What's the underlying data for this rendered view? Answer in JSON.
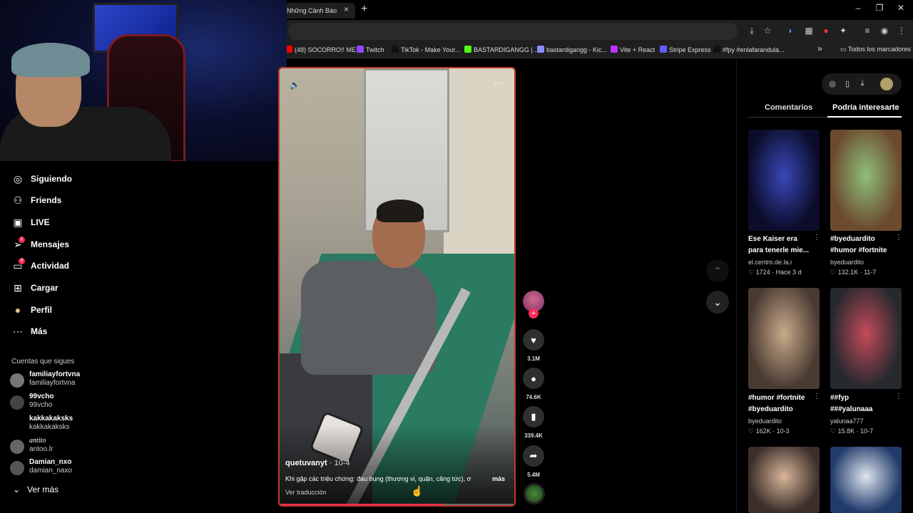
{
  "browser": {
    "tab_title": "Những Cảnh Báo",
    "tab_close": "×",
    "new_tab": "+",
    "win_minimize": "–",
    "win_restore": "❐",
    "win_close": "✕",
    "bookmarks": [
      {
        "label": "(48) SOCORRO!! ME...",
        "color": "#ff0000"
      },
      {
        "label": "Twitch",
        "color": "#9146ff"
      },
      {
        "label": "TikTok - Make Your...",
        "color": "#111111"
      },
      {
        "label": "BASTARDIGANGG |...",
        "color": "#53fc18"
      },
      {
        "label": "bastardigangg - Kic...",
        "color": "#8c8cff"
      },
      {
        "label": "Vite + React",
        "color": "#bd34fe"
      },
      {
        "label": "Stripe Express",
        "color": "#635bff"
      },
      {
        "label": "#fpy #enlafarandula...",
        "color": "#111111"
      }
    ],
    "bookmarks_overflow": "»",
    "all_bookmarks": "Todos los marcadores"
  },
  "sidebar": {
    "items": [
      {
        "label": "Siguiendo",
        "icon": "following-icon",
        "glyph": "◎"
      },
      {
        "label": "Friends",
        "icon": "friends-icon",
        "glyph": "⚇"
      },
      {
        "label": "LIVE",
        "icon": "live-icon",
        "glyph": "▣"
      },
      {
        "label": "Mensajes",
        "icon": "messages-icon",
        "glyph": "➢",
        "badge": "1"
      },
      {
        "label": "Actividad",
        "icon": "activity-icon",
        "glyph": "▭",
        "badge": "9"
      },
      {
        "label": "Cargar",
        "icon": "upload-icon",
        "glyph": "⊞"
      },
      {
        "label": "Perfil",
        "icon": "profile-icon",
        "glyph": "●"
      },
      {
        "label": "Más",
        "icon": "more-icon",
        "glyph": "⋯"
      }
    ],
    "following_title": "Cuentas que sigues",
    "accounts": [
      {
        "name": "familiayfortvna",
        "handle": "familiayfortvna",
        "color": "#777"
      },
      {
        "name": "99vcho",
        "handle": "99vcho",
        "color": "#444"
      },
      {
        "name": "kakkakaksks",
        "handle": "kakkakaksks",
        "color": "#000"
      },
      {
        "name": "antito",
        "handle": "antoo.lr",
        "color": "#666"
      },
      {
        "name": "Damian_nxo",
        "handle": "damian_naxo",
        "color": "#555"
      }
    ],
    "see_more": "Ver más"
  },
  "video": {
    "author": "quetuvanyt",
    "date": " · 10-4",
    "caption": "Khi gặp các triệu chứng: đau bụng (thượng vị, quặn, căng tức), ơ",
    "more": "más",
    "translate": "Ver traducción",
    "progress": 0.69,
    "mute_icon": "🔈",
    "more_icon": "⋯"
  },
  "actions": {
    "likes": "3.1M",
    "comments": "74.6K",
    "saves": "339.4K",
    "shares": "5.4M",
    "follow_plus": "+"
  },
  "nav": {
    "up": "⌃",
    "down": "⌄"
  },
  "right_panel": {
    "tab_comments": "Comentarios",
    "tab_interest": "Podría interesarte",
    "cards": [
      {
        "title1": "Ese Kaiser era",
        "title2": "para tenerle mie...",
        "author": "el.centro.de.la.i",
        "meta": "♡ 1724  ·  Hace 3 d",
        "bg": "#0b0d2a",
        "accent": "#3a47b8"
      },
      {
        "title1": "#byeduardito",
        "title2": "#humor #fortnite",
        "author": "byeduardito",
        "meta": "♡ 132.1K  ·  11-7",
        "bg": "#6b4a2e",
        "accent": "#8fbf7a"
      },
      {
        "title1": "#humor #fortnite",
        "title2": "#byeduardito",
        "author": "byeduardito",
        "meta": "♡ 162K  ·  10-3",
        "bg": "#4a3b32",
        "accent": "#c9a98a"
      },
      {
        "title1": "##fyp",
        "title2": "###yalunaaa",
        "author": "yalunaa777",
        "meta": "♡ 15.8K  ·  10-7",
        "bg": "#26292e",
        "accent": "#c44a5a"
      },
      {
        "title1": "",
        "title2": "",
        "author": "",
        "meta": "",
        "bg": "#3c2f2a",
        "accent": "#d9b59a"
      },
      {
        "title1": "",
        "title2": "",
        "author": "",
        "meta": "",
        "bg": "#203a6a",
        "accent": "#dfe6ef"
      }
    ]
  }
}
